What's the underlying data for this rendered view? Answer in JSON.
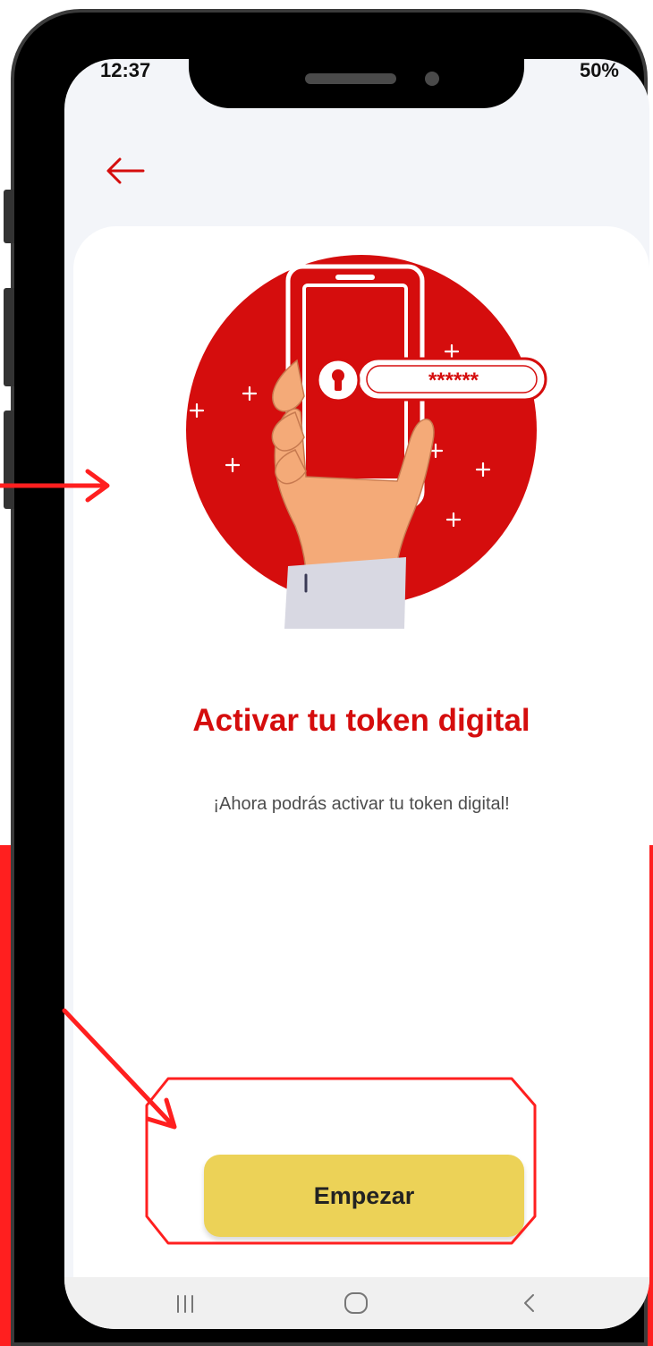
{
  "status_bar": {
    "time": "12:37",
    "right_text": "50%"
  },
  "main": {
    "title": "Activar tu token digital",
    "subtitle": "¡Ahora podrás activar tu token digital!",
    "password_mask": "******",
    "start_button_label": "Empezar"
  },
  "colors": {
    "brand_red": "#d50d0d",
    "button_yellow": "#ecd257",
    "annotation_red": "#ff1f1f"
  },
  "icons": {
    "back": "arrow-left-icon",
    "nav_recent": "recent-apps-icon",
    "nav_home": "home-icon",
    "nav_back": "chevron-left-icon"
  }
}
